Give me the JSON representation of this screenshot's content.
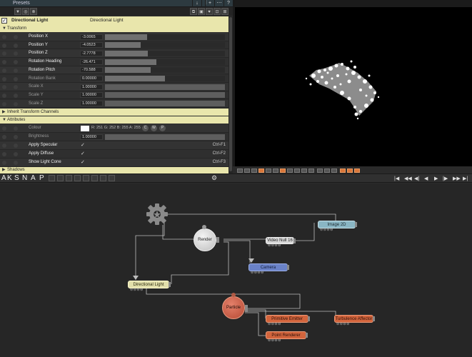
{
  "presets": {
    "title": "Presets",
    "tools": [
      "↓",
      "⫶",
      "+",
      "⋯",
      "?"
    ],
    "sub_tools": [
      "⧉",
      "▣",
      "♥",
      "⊡",
      "⊞"
    ]
  },
  "object": {
    "name": "Directional Light",
    "type": "Directional Light"
  },
  "sections": {
    "transform": "Transform",
    "inherit": "Inherit Transform Channels",
    "attributes": "Attributes",
    "shadows": "Shadows"
  },
  "transform_rows": [
    {
      "label": "Position X",
      "value": "-3.0065",
      "fill": 0.35
    },
    {
      "label": "Position Y",
      "value": "-4.0523",
      "fill": 0.3
    },
    {
      "label": "Position Z",
      "value": "-2.7778",
      "fill": 0.36
    },
    {
      "label": "Rotation Heading",
      "value": "-26.471",
      "fill": 0.43
    },
    {
      "label": "Rotation Pitch",
      "value": "-70.588",
      "fill": 0.38
    },
    {
      "label": "Rotation Bank",
      "value": "0.00000",
      "fill": 0.5
    },
    {
      "label": "Scale X",
      "value": "1.00000",
      "fill": 1.0
    },
    {
      "label": "Scale Y",
      "value": "1.00000",
      "fill": 1.0
    },
    {
      "label": "Scale Z",
      "value": "1.00000",
      "fill": 1.0
    }
  ],
  "attributes": {
    "colour_label": "Colour",
    "colour_rgba": "R: 251  G: 252  B: 255  A: 255",
    "colour_chips": [
      "C",
      "W",
      "P"
    ],
    "brightness_label": "Brightness",
    "brightness_value": "1.00000",
    "apply_specular": "Apply Specular",
    "apply_specular_key": "Ctrl-F1",
    "apply_diffuse": "Apply Diffuse",
    "apply_diffuse_key": "Ctrl-F2",
    "show_light_cone": "Show Light Cone",
    "show_light_cone_key": "Ctrl-F3",
    "check": "✓"
  },
  "midbar": {
    "snap_letters": [
      "A",
      "K",
      "S",
      "N",
      "A",
      "P"
    ],
    "transport": [
      "|◀",
      "◀◀",
      "◀|",
      "◀",
      "▶",
      "|▶",
      "▶▶",
      "▶|"
    ]
  },
  "nodes": {
    "render": "Render",
    "video_null": "Video Null 16",
    "image_2d": "Image 2D",
    "camera": "Camera",
    "directional_light": "Directional Light",
    "particle": "Particle",
    "primitive_emitter": "Primitive Emitter",
    "turbulence_affector": "Turbulence Affector",
    "point_renderer": "Point Renderer",
    "ports": "⊖⊖⊖⊖"
  },
  "colors": {
    "section_yellow": "#e9e6ac",
    "node_orange": "#d2643c",
    "node_blue": "#6a82c8",
    "node_teal": "#8ab6c4",
    "accent_orange": "#d9773a"
  }
}
